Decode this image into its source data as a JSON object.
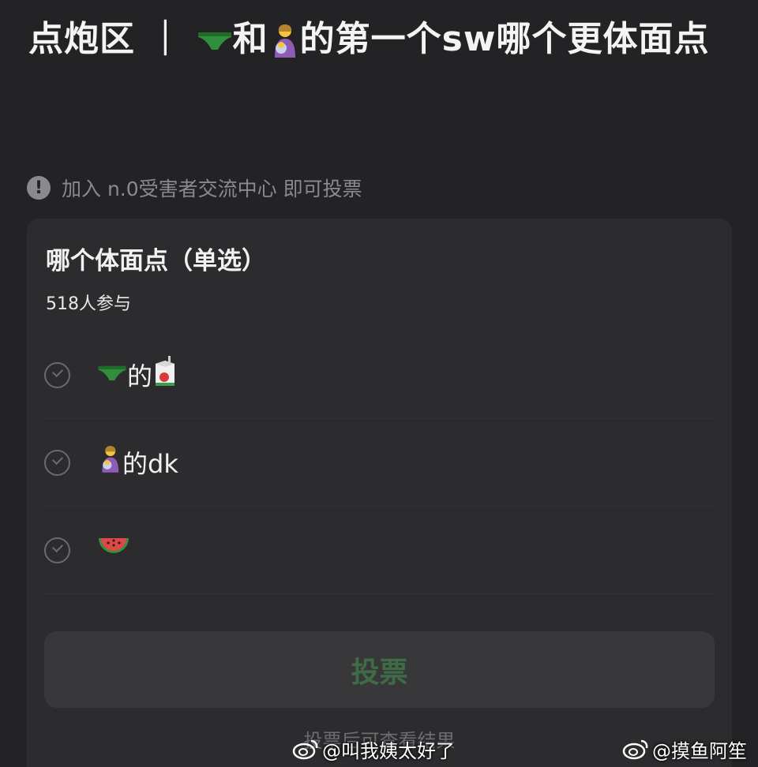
{
  "post": {
    "title_parts": [
      "点炮区 ｜ ",
      "和",
      "的第一个sw哪个更体面点"
    ]
  },
  "notice": {
    "text": "加入 n.0受害者交流中心 即可投票"
  },
  "poll": {
    "title": "哪个体面点（单选）",
    "participants": "518人参与",
    "options": [
      {
        "suffix": "的",
        "icons": [
          "green-underwear-icon",
          "juice-box-icon"
        ]
      },
      {
        "suffix": "的dk",
        "icons": [
          "person-feeding-baby-icon"
        ]
      },
      {
        "suffix": "",
        "icons": [
          "watermelon-icon"
        ]
      }
    ],
    "vote_label": "投票",
    "after_note": "投票后可查看结果"
  },
  "watermarks": [
    "@叫我姨太好了",
    "@摸鱼阿笙"
  ],
  "colors": {
    "background": "#232325",
    "card": "#2c2c2f",
    "vote_text": "#3f6b47",
    "muted": "#8a8a8c"
  }
}
